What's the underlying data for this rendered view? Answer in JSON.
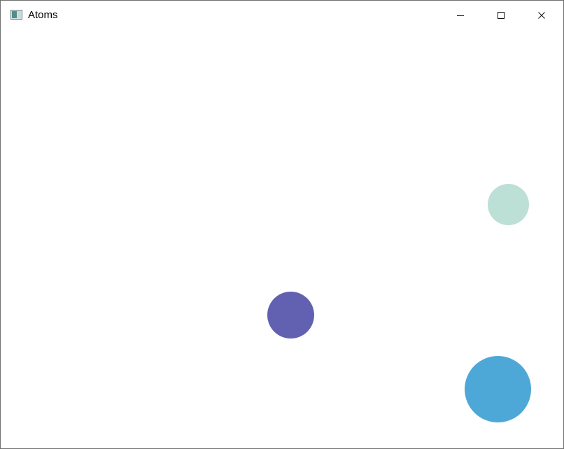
{
  "window": {
    "title": "Atoms",
    "controls": {
      "minimize_icon": "minimize-icon",
      "maximize_icon": "maximize-icon",
      "close_icon": "close-icon"
    }
  },
  "canvas": {
    "background": "#ffffff",
    "atoms": [
      {
        "name": "atom-mint",
        "color": "#bcdfd6"
      },
      {
        "name": "atom-purple",
        "color": "#6260b0"
      },
      {
        "name": "atom-blue",
        "color": "#4ea8d7"
      }
    ]
  }
}
